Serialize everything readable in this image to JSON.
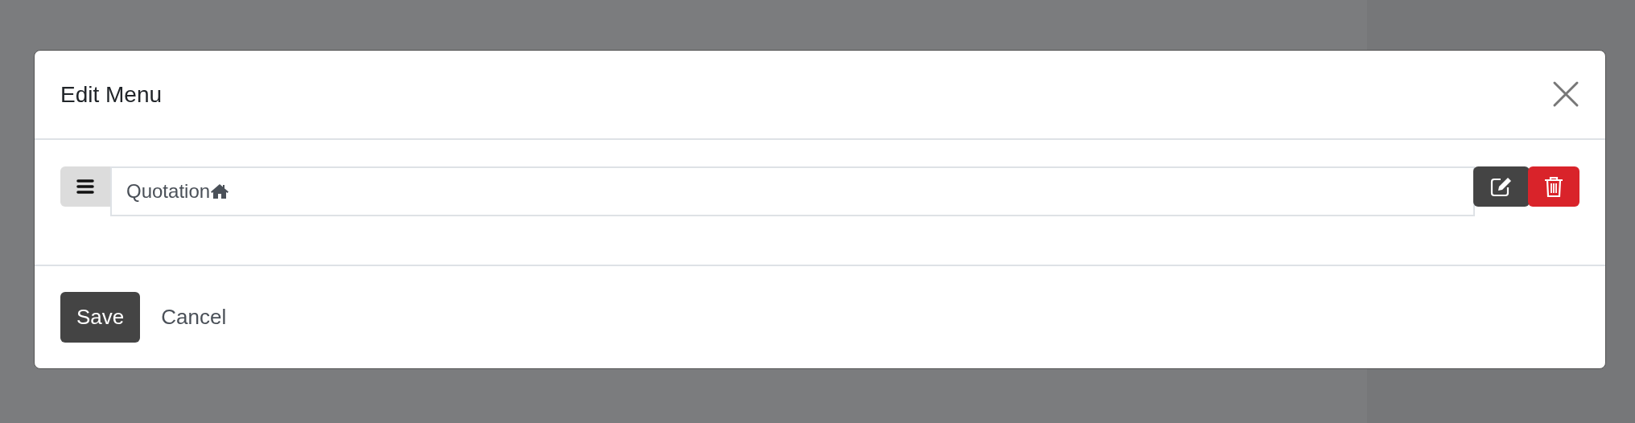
{
  "dialog": {
    "title": "Edit Menu",
    "menu_items": [
      {
        "label": "Quotation"
      }
    ],
    "buttons": [
      {
        "label": "Save",
        "kind": "primary"
      },
      {
        "label": "Cancel",
        "kind": "link"
      }
    ]
  }
}
